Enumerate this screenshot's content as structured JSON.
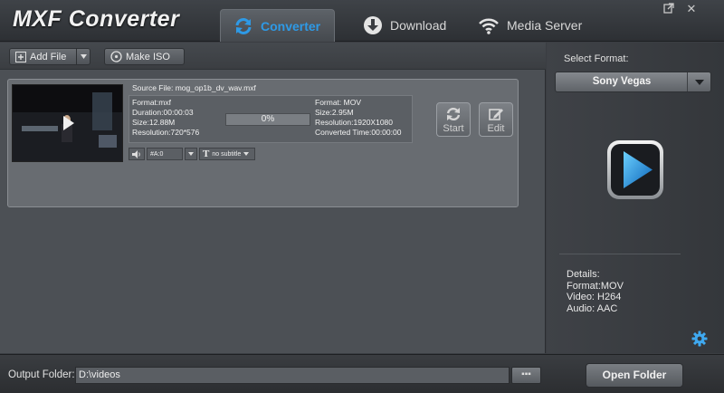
{
  "app": {
    "title": "MXF Converter"
  },
  "tabs": [
    {
      "label": "Converter",
      "icon": "refresh-icon",
      "active": true
    },
    {
      "label": "Download",
      "icon": "download-icon",
      "active": false
    },
    {
      "label": "Media Server",
      "icon": "wifi-icon",
      "active": false
    }
  ],
  "window": {
    "popout_icon": "popout-icon",
    "close_glyph": "✕"
  },
  "toolbar": {
    "add_file_label": "Add File",
    "make_iso_label": "Make ISO"
  },
  "file_item": {
    "source_file": "Source File: mog_op1b_dv_wav.mxf",
    "source": [
      "Format:mxf",
      "Duration:00:00:03",
      "Size:12.88M",
      "Resolution:720*576"
    ],
    "progress_text": "0%",
    "progress": 0,
    "target": [
      "Format: MOV",
      "Size:2.95M",
      "Resolution:1920X1080",
      "Converted Time:00:00:00"
    ],
    "start_label": "Start",
    "edit_label": "Edit",
    "audio_track": "#A:0",
    "subtitle": "no subtitle"
  },
  "format_panel": {
    "label": "Select Format:",
    "selected": "Sony Vegas",
    "details_title": "Details:",
    "details": [
      "Format:MOV",
      "Video: H264",
      "Audio: AAC"
    ]
  },
  "footer": {
    "output_label": "Output Folder:",
    "output_path": "D:\\videos",
    "browse_label": "▪▪▪",
    "open_folder_label": "Open Folder"
  },
  "colors": {
    "accent": "#2e9ae6",
    "background": "#4c5055"
  }
}
